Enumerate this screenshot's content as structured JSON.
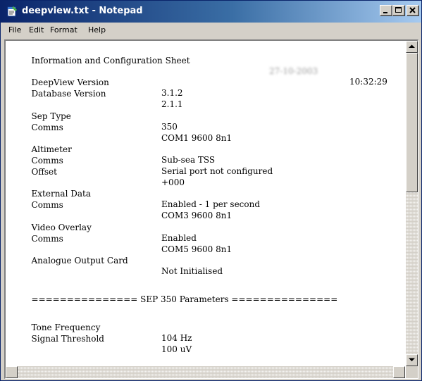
{
  "window": {
    "title": "deepview.txt - Notepad",
    "icon": "notepad-icon",
    "titlebar_color": "#0a246a"
  },
  "menu": [
    "File",
    "Edit",
    "Format",
    "Help"
  ],
  "document": {
    "header": "Information and Configuration Sheet",
    "date": "27-10-2003",
    "time": "10:32:29",
    "lines": [
      {
        "label": "DeepView Version",
        "value": "3.1.2"
      },
      {
        "label": "Database Version",
        "value": "2.1.1"
      },
      {
        "label": "Sep Type",
        "value": "350"
      },
      {
        "label": "Comms",
        "value": "COM1 9600 8n1"
      },
      {
        "label": "Altimeter",
        "value": "Sub-sea TSS"
      },
      {
        "label": "Comms",
        "value": "Serial port not configured"
      },
      {
        "label": "Offset",
        "value": "+000"
      },
      {
        "label": "External Data",
        "value": "Enabled - 1 per second"
      },
      {
        "label": "Comms",
        "value": "COM3 9600 8n1"
      },
      {
        "label": "Video Overlay",
        "value": "Enabled"
      },
      {
        "label": "Comms",
        "value": "COM5 9600 8n1"
      },
      {
        "label": "Analogue Output Card",
        "value": "Not Initialised"
      },
      {
        "label": "Tone Frequency",
        "value": "104 Hz"
      },
      {
        "label": "Signal Threshold",
        "value": "100 uV"
      }
    ],
    "separator": "=============== SEP 350 Parameters ==============="
  }
}
